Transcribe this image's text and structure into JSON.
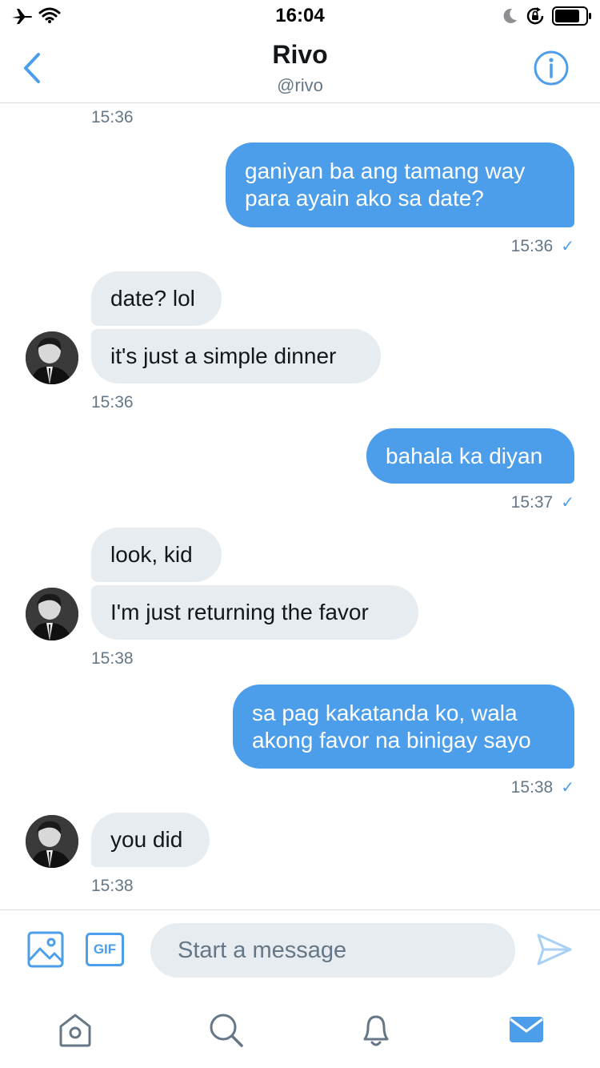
{
  "status_bar": {
    "time": "16:04"
  },
  "header": {
    "title": "Rivo",
    "handle": "@rivo"
  },
  "messages": [
    {
      "time": "15:36"
    },
    {
      "text_line1": "ganiyan ba ang tamang way",
      "text_line2": "para ayain ako sa date?",
      "time": "15:36",
      "check": "✓"
    },
    {
      "text1": "date? lol",
      "text2": "it's just a simple dinner",
      "time": "15:36"
    },
    {
      "text": "bahala ka diyan",
      "time": "15:37",
      "check": "✓"
    },
    {
      "text1": "look, kid",
      "text2": "I'm just returning the favor",
      "time": "15:38"
    },
    {
      "text_line1": "sa pag kakatanda ko, wala",
      "text_line2": "akong favor na binigay sayo",
      "time": "15:38",
      "check": "✓"
    },
    {
      "text": "you did",
      "time": "15:38"
    }
  ],
  "composer": {
    "placeholder": "Start a message",
    "gif_label": "GIF"
  },
  "colors": {
    "accent": "#4c9eeb",
    "incoming_bubble": "#e6ecf0",
    "meta_text": "#657786"
  },
  "icons": {
    "status": [
      "airplane-icon",
      "wifi-icon",
      "moon-icon",
      "rotation-lock-icon",
      "battery-icon"
    ],
    "header": [
      "back-chevron-icon",
      "info-icon"
    ],
    "composer": [
      "image-icon",
      "gif-icon",
      "send-icon"
    ],
    "tabs": [
      "home-icon",
      "search-icon",
      "notifications-icon",
      "messages-icon"
    ]
  }
}
